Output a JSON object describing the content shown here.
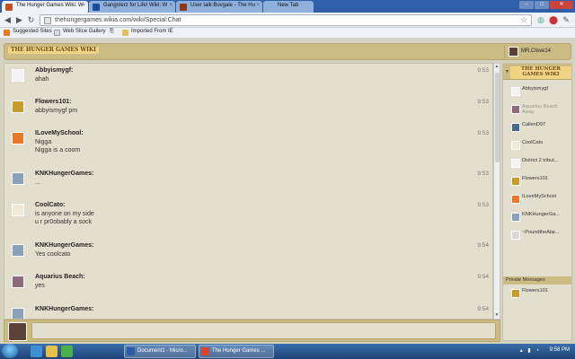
{
  "browser": {
    "tabs": [
      {
        "label": "The Hunger Games Wiki: W",
        "active": true
      },
      {
        "label": "Gangsterz for Life! Wiki: W",
        "active": false
      },
      {
        "label": "User talk:Buvgale - The Hu",
        "active": false
      },
      {
        "label": "New Tab",
        "active": false
      }
    ],
    "tab_close_glyph": "×",
    "url": "thehungergames.wikia.com/wiki/Special:Chat",
    "bookmarks": [
      "Suggested Sites",
      "Web Slice Gallery",
      "Imported From IE"
    ],
    "window_controls": {
      "minimize": "–",
      "maximize": "□",
      "close": "✕"
    }
  },
  "chat": {
    "logo_line1": "THE",
    "logo_line2": "HUNGER GAMES",
    "logo_line3": "WIKI",
    "current_user": "MR.Clove14",
    "messages": [
      {
        "user": "Abbyismygf:",
        "time": "9:53",
        "lines": [
          "ahah"
        ],
        "avatar": "#f4f4f4"
      },
      {
        "user": "Flowers101:",
        "time": "9:53",
        "lines": [
          "abbyismygf pm"
        ],
        "avatar": "#c89b2d"
      },
      {
        "user": "ILoveMySchool:",
        "time": "9:53",
        "lines": [
          "Nigga",
          "Nigga is a coom"
        ],
        "avatar": "#e8782a"
      },
      {
        "user": "KNKHungerGames:",
        "time": "9:53",
        "lines": [
          "..."
        ],
        "avatar": "#8aa2b9"
      },
      {
        "user": "CoolCato:",
        "time": "9:53",
        "lines": [
          "is anyone on my side",
          "u r pr0obably a sock"
        ],
        "avatar": "#f2e8d8"
      },
      {
        "user": "KNKHungerGames:",
        "time": "9:54",
        "lines": [
          "Yes coolcato"
        ],
        "avatar": "#8aa2b9"
      },
      {
        "user": "Aquarius Beach:",
        "time": "9:54",
        "lines": [
          "yes"
        ],
        "avatar": "#8e6a7a"
      },
      {
        "user": "KNKHungerGames:",
        "time": "9:54",
        "lines": [],
        "avatar": "#8aa2b9"
      }
    ],
    "users": [
      {
        "name": "Abbyismygf",
        "sub": "",
        "away": false,
        "avatar": "#f4f4f4"
      },
      {
        "name": "Aquarius Beach",
        "sub": "Away",
        "away": true,
        "avatar": "#8e6a7a"
      },
      {
        "name": "CallenD97",
        "sub": "",
        "away": false,
        "avatar": "#4b6a8a"
      },
      {
        "name": "CoolCato",
        "sub": "",
        "away": false,
        "avatar": "#f2e8d8"
      },
      {
        "name": "District 2 tribut...",
        "sub": "",
        "away": false,
        "avatar": "#f4f4f4"
      },
      {
        "name": "Flowers101",
        "sub": "",
        "away": false,
        "avatar": "#c89b2d"
      },
      {
        "name": "ILoveMySchool",
        "sub": "",
        "away": false,
        "avatar": "#e8782a"
      },
      {
        "name": "KNKHungerGa...",
        "sub": "",
        "away": false,
        "avatar": "#8aa2b9"
      },
      {
        "name": "~PoundtheAlar...",
        "sub": "",
        "away": false,
        "avatar": "#d8d8d8"
      }
    ],
    "private_messages_label": "Private Messages",
    "private_users": [
      {
        "name": "Flowers101",
        "avatar": "#c89b2d"
      }
    ],
    "input_value": ""
  },
  "taskbar": {
    "tasks": [
      "Document1 - Micro...",
      "The Hunger Games ..."
    ],
    "clock": "9:58 PM"
  }
}
